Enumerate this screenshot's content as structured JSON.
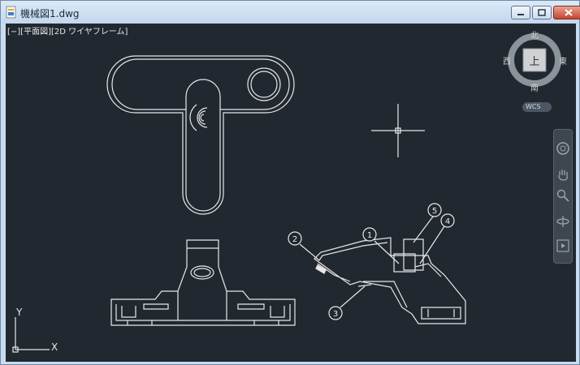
{
  "window": {
    "title": "機械図1.dwg",
    "minimize_icon": "minimize-icon",
    "maximize_icon": "maximize-icon",
    "close_icon": "close-icon"
  },
  "viewport": {
    "label": "[−][平面図][2D ワイヤフレーム]",
    "background": "#212830"
  },
  "viewcube": {
    "top_label": "上",
    "north": "北",
    "south": "南",
    "east": "東",
    "west": "西",
    "wcs_label": "WCS"
  },
  "navigation_bar": {
    "tools": [
      "steering-wheel-icon",
      "pan-icon",
      "zoom-icon",
      "orbit-icon",
      "showmotion-icon"
    ]
  },
  "ucs": {
    "x_label": "X",
    "y_label": "Y"
  },
  "callouts": [
    "1",
    "2",
    "3",
    "4",
    "5"
  ]
}
